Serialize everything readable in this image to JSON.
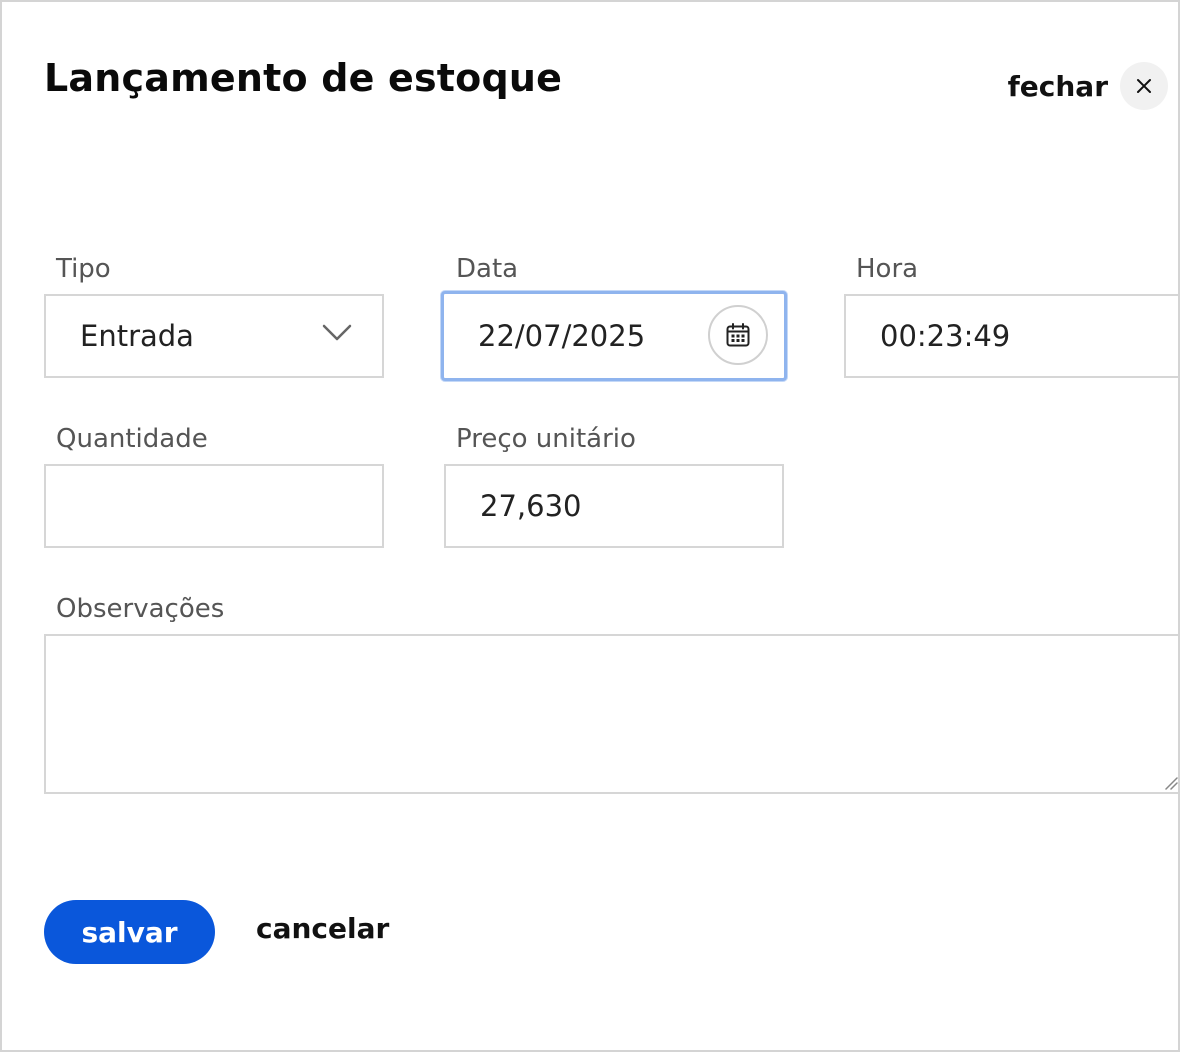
{
  "dialog": {
    "title": "Lançamento de estoque",
    "close_label": "fechar"
  },
  "form": {
    "tipo": {
      "label": "Tipo",
      "value": "Entrada"
    },
    "data": {
      "label": "Data",
      "value": "22/07/2025"
    },
    "hora": {
      "label": "Hora",
      "value": "00:23:49"
    },
    "quantidade": {
      "label": "Quantidade",
      "value": ""
    },
    "preco": {
      "label": "Preço unitário",
      "value": "27,630"
    },
    "observacoes": {
      "label": "Observações",
      "value": ""
    }
  },
  "actions": {
    "save_label": "salvar",
    "cancel_label": "cancelar"
  },
  "colors": {
    "primary": "#0a57db",
    "focus_border": "#8fb4ee",
    "field_border": "#d6d6d6"
  },
  "icons": [
    "close-icon",
    "chevron-down-icon",
    "calendar-icon",
    "resize-handle-icon"
  ]
}
